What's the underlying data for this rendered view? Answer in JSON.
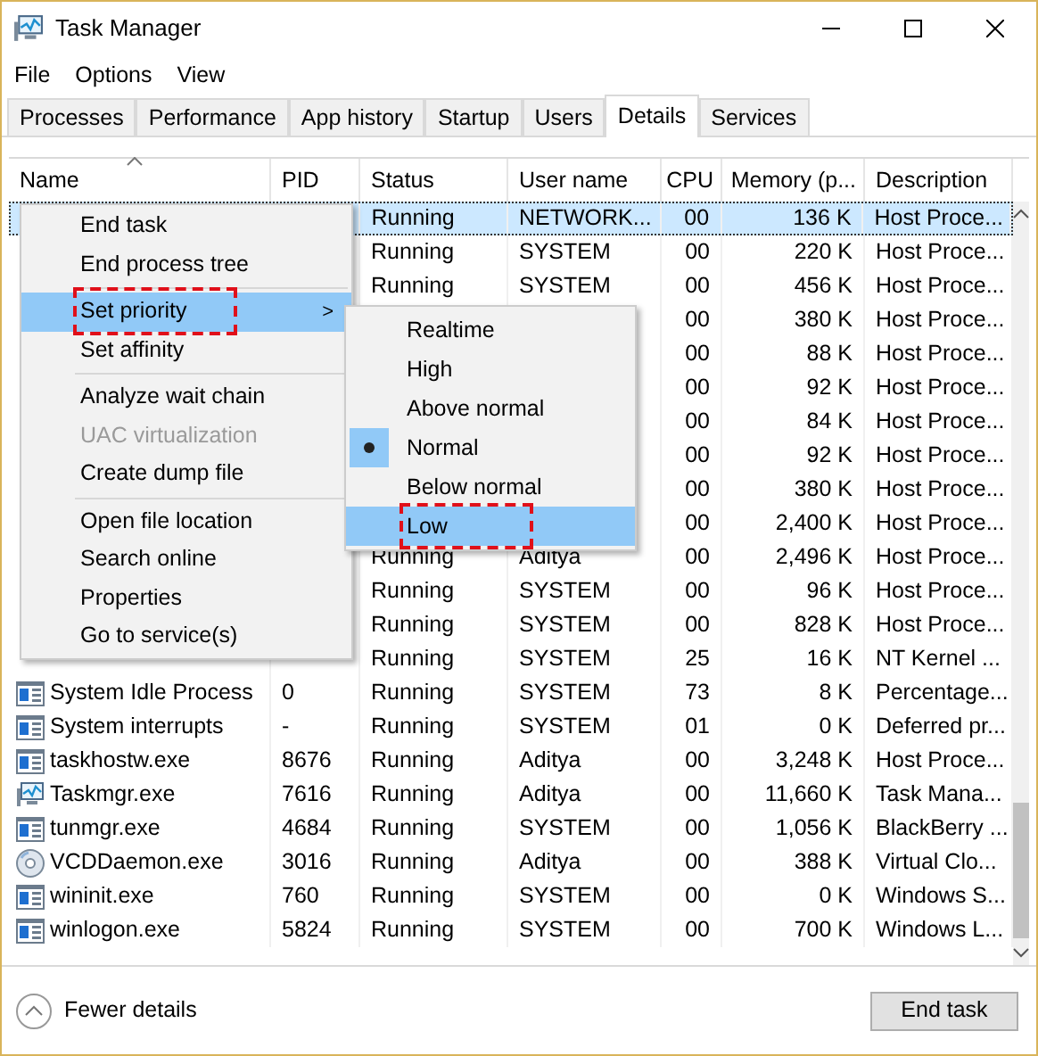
{
  "window": {
    "title": "Task Manager"
  },
  "menu_bar": [
    "File",
    "Options",
    "View"
  ],
  "tabs": [
    {
      "label": "Processes",
      "selected": false
    },
    {
      "label": "Performance",
      "selected": false
    },
    {
      "label": "App history",
      "selected": false
    },
    {
      "label": "Startup",
      "selected": false
    },
    {
      "label": "Users",
      "selected": false
    },
    {
      "label": "Details",
      "selected": true
    },
    {
      "label": "Services",
      "selected": false
    }
  ],
  "table": {
    "columns": [
      "Name",
      "PID",
      "Status",
      "User name",
      "CPU",
      "Memory (p...",
      "Description"
    ],
    "rows": [
      {
        "status": "Running",
        "user": "NETWORK...",
        "cpu": "00",
        "memory": "136 K",
        "description": "Host Proce...",
        "selected": true
      },
      {
        "status": "Running",
        "user": "SYSTEM",
        "cpu": "00",
        "memory": "220 K",
        "description": "Host Proce...",
        "selected": false
      },
      {
        "status": "Running",
        "user": "SYSTEM",
        "cpu": "00",
        "memory": "456 K",
        "description": "Host Proce...",
        "selected": false
      },
      {
        "cpu": "00",
        "memory": "380 K",
        "description": "Host Proce...",
        "selected": false
      },
      {
        "cpu": "00",
        "memory": "88 K",
        "description": "Host Proce...",
        "selected": false
      },
      {
        "cpu": "00",
        "memory": "92 K",
        "description": "Host Proce...",
        "selected": false
      },
      {
        "cpu": "00",
        "memory": "84 K",
        "description": "Host Proce...",
        "selected": false
      },
      {
        "cpu": "00",
        "memory": "92 K",
        "description": "Host Proce...",
        "selected": false
      },
      {
        "cpu": "00",
        "memory": "380 K",
        "description": "Host Proce...",
        "selected": false
      },
      {
        "cpu": "00",
        "memory": "2,400 K",
        "description": "Host Proce...",
        "selected": false
      },
      {
        "status": "Running",
        "user": "Aditya",
        "cpu": "00",
        "memory": "2,496 K",
        "description": "Host Proce...",
        "selected": false
      },
      {
        "status": "Running",
        "user": "SYSTEM",
        "cpu": "00",
        "memory": "96 K",
        "description": "Host Proce...",
        "selected": false
      },
      {
        "status": "Running",
        "user": "SYSTEM",
        "cpu": "00",
        "memory": "828 K",
        "description": "Host Proce...",
        "selected": false
      },
      {
        "status": "Running",
        "user": "SYSTEM",
        "cpu": "25",
        "memory": "16 K",
        "description": "NT Kernel ...",
        "selected": false
      },
      {
        "kind": "app",
        "name": "System Idle Process",
        "pid": "0",
        "status": "Running",
        "user": "SYSTEM",
        "cpu": "73",
        "memory": "8 K",
        "description": "Percentage...",
        "selected": false
      },
      {
        "kind": "app",
        "name": "System interrupts",
        "pid": "-",
        "status": "Running",
        "user": "SYSTEM",
        "cpu": "01",
        "memory": "0 K",
        "description": "Deferred pr...",
        "selected": false
      },
      {
        "kind": "app",
        "name": "taskhostw.exe",
        "pid": "8676",
        "status": "Running",
        "user": "Aditya",
        "cpu": "00",
        "memory": "3,248 K",
        "description": "Host Proce...",
        "selected": false
      },
      {
        "kind": "monitor",
        "name": "Taskmgr.exe",
        "pid": "7616",
        "status": "Running",
        "user": "Aditya",
        "cpu": "00",
        "memory": "11,660 K",
        "description": "Task Mana...",
        "selected": false
      },
      {
        "kind": "app",
        "name": "tunmgr.exe",
        "pid": "4684",
        "status": "Running",
        "user": "SYSTEM",
        "cpu": "00",
        "memory": "1,056 K",
        "description": "BlackBerry ...",
        "selected": false
      },
      {
        "kind": "disc",
        "name": "VCDDaemon.exe",
        "pid": "3016",
        "status": "Running",
        "user": "Aditya",
        "cpu": "00",
        "memory": "388 K",
        "description": "Virtual Clo...",
        "selected": false
      },
      {
        "kind": "app",
        "name": "wininit.exe",
        "pid": "760",
        "status": "Running",
        "user": "SYSTEM",
        "cpu": "00",
        "memory": "0 K",
        "description": "Windows S...",
        "selected": false
      },
      {
        "kind": "app",
        "name": "winlogon.exe",
        "pid": "5824",
        "status": "Running",
        "user": "SYSTEM",
        "cpu": "00",
        "memory": "700 K",
        "description": "Windows L...",
        "selected": false
      }
    ]
  },
  "context_menu": [
    {
      "kind": "item",
      "label": "End task",
      "disabled": false,
      "selected": false,
      "marked": false
    },
    {
      "kind": "item",
      "label": "End process tree",
      "disabled": false,
      "selected": false,
      "marked": false
    },
    {
      "kind": "separator"
    },
    {
      "kind": "submenu",
      "label": "Set priority",
      "arrow": ">",
      "disabled": false,
      "selected": true,
      "marked": true
    },
    {
      "kind": "item",
      "label": "Set affinity",
      "disabled": false,
      "selected": false,
      "marked": false
    },
    {
      "kind": "separator"
    },
    {
      "kind": "item",
      "label": "Analyze wait chain",
      "disabled": false,
      "selected": false,
      "marked": false
    },
    {
      "kind": "item",
      "label": "UAC virtualization",
      "disabled": true,
      "selected": false,
      "marked": false
    },
    {
      "kind": "item",
      "label": "Create dump file",
      "disabled": false,
      "selected": false,
      "marked": false
    },
    {
      "kind": "separator"
    },
    {
      "kind": "item",
      "label": "Open file location",
      "disabled": false,
      "selected": false,
      "marked": false
    },
    {
      "kind": "item",
      "label": "Search online",
      "disabled": false,
      "selected": false,
      "marked": false
    },
    {
      "kind": "item",
      "label": "Properties",
      "disabled": false,
      "selected": false,
      "marked": false
    },
    {
      "kind": "item",
      "label": "Go to service(s)",
      "disabled": false,
      "selected": false,
      "marked": false
    }
  ],
  "priority_submenu": [
    {
      "label": "Realtime",
      "checked": false,
      "selected": false,
      "marked": false
    },
    {
      "label": "High",
      "checked": false,
      "selected": false,
      "marked": false
    },
    {
      "label": "Above normal",
      "checked": false,
      "selected": false,
      "marked": false
    },
    {
      "label": "Normal",
      "checked": true,
      "selected": false,
      "marked": false
    },
    {
      "label": "Below normal",
      "checked": false,
      "selected": false,
      "marked": false
    },
    {
      "label": "Low",
      "checked": false,
      "selected": true,
      "marked": true
    }
  ],
  "footer": {
    "toggle": "Fewer details",
    "button": "End task"
  }
}
